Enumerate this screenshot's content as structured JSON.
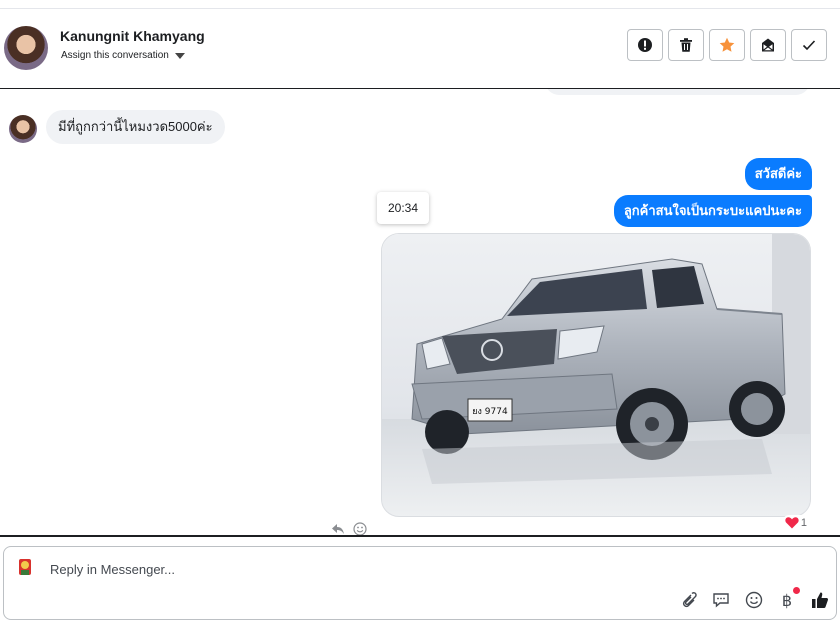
{
  "header": {
    "contact_name": "Kanungnit Khamyang",
    "assign_label": "Assign this conversation",
    "actions": [
      {
        "name": "mark-spam-button",
        "icon": "alert-icon"
      },
      {
        "name": "delete-button",
        "icon": "trash-icon"
      },
      {
        "name": "star-button",
        "icon": "star-icon",
        "color": "#f7923b"
      },
      {
        "name": "mark-unread-button",
        "icon": "envelope-icon"
      },
      {
        "name": "mark-done-button",
        "icon": "check-icon"
      }
    ]
  },
  "thread": {
    "incoming": [
      {
        "text": "มีที่ถูกกว่านี้ไหมงวด5000ค่ะ"
      }
    ],
    "outgoing": [
      {
        "text": "สวัสดีค่ะ"
      },
      {
        "text": "ลูกค้าสนใจเป็นกระบะแคปนะคะ"
      }
    ],
    "timestamp": "20:34",
    "photo": {
      "plate_text": "ยง 9774",
      "subject": "silver-pickup-truck"
    },
    "reaction": {
      "icon": "heart-icon",
      "count": "1",
      "color": "#f02849"
    }
  },
  "composer": {
    "placeholder": "Reply in Messenger...",
    "tools": [
      "paperclip-icon",
      "comment-icon",
      "emoji-icon",
      "baht-icon",
      "thumbs-up-icon"
    ]
  },
  "colors": {
    "outgoing_bubble": "#0a7cff",
    "incoming_bubble": "#f0f2f5",
    "accent_star": "#f7923b"
  }
}
